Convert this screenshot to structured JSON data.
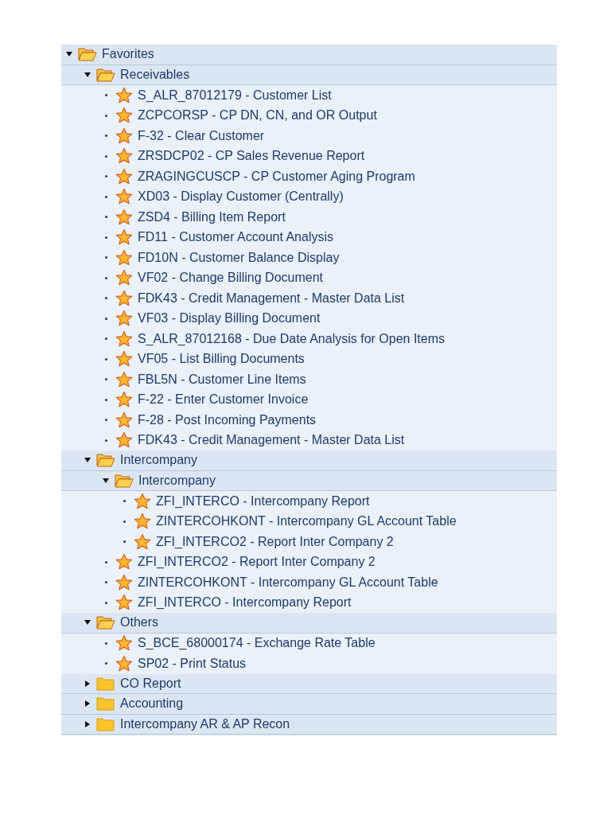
{
  "tree": [
    {
      "kind": "folder",
      "label": "Favorites",
      "expanded": true,
      "children": [
        {
          "kind": "folder",
          "label": "Receivables",
          "expanded": true,
          "children": [
            {
              "kind": "transaction",
              "label": "S_ALR_87012179 - Customer List"
            },
            {
              "kind": "transaction",
              "label": "ZCPCORSP - CP DN, CN, and OR Output"
            },
            {
              "kind": "transaction",
              "label": "F-32 - Clear Customer"
            },
            {
              "kind": "transaction",
              "label": "ZRSDCP02 - CP Sales Revenue Report"
            },
            {
              "kind": "transaction",
              "label": "ZRAGINGCUSCP - CP Customer Aging Program"
            },
            {
              "kind": "transaction",
              "label": "XD03 - Display Customer (Centrally)"
            },
            {
              "kind": "transaction",
              "label": "ZSD4 - Billing Item Report"
            },
            {
              "kind": "transaction",
              "label": "FD11 - Customer Account Analysis"
            },
            {
              "kind": "transaction",
              "label": "FD10N - Customer Balance Display"
            },
            {
              "kind": "transaction",
              "label": "VF02 - Change Billing Document"
            },
            {
              "kind": "transaction",
              "label": "FDK43 - Credit Management - Master Data List"
            },
            {
              "kind": "transaction",
              "label": "VF03 - Display Billing Document"
            },
            {
              "kind": "transaction",
              "label": "S_ALR_87012168 - Due Date Analysis for Open Items"
            },
            {
              "kind": "transaction",
              "label": "VF05 - List Billing Documents"
            },
            {
              "kind": "transaction",
              "label": "FBL5N - Customer Line Items"
            },
            {
              "kind": "transaction",
              "label": "F-22 - Enter Customer Invoice"
            },
            {
              "kind": "transaction",
              "label": "F-28 - Post Incoming Payments"
            },
            {
              "kind": "transaction",
              "label": "FDK43 - Credit Management - Master Data List"
            }
          ]
        },
        {
          "kind": "folder",
          "label": "Intercompany",
          "expanded": true,
          "children": [
            {
              "kind": "folder",
              "label": "Intercompany",
              "expanded": true,
              "children": [
                {
                  "kind": "transaction",
                  "label": "ZFI_INTERCO - Intercompany Report"
                },
                {
                  "kind": "transaction",
                  "label": "ZINTERCOHKONT - Intercompany GL Account Table"
                },
                {
                  "kind": "transaction",
                  "label": "ZFI_INTERCO2 - Report Inter Company 2"
                }
              ]
            },
            {
              "kind": "transaction",
              "label": "ZFI_INTERCO2 - Report Inter Company 2"
            },
            {
              "kind": "transaction",
              "label": "ZINTERCOHKONT - Intercompany GL Account Table"
            },
            {
              "kind": "transaction",
              "label": "ZFI_INTERCO - Intercompany Report"
            }
          ]
        },
        {
          "kind": "folder",
          "label": "Others",
          "expanded": true,
          "children": [
            {
              "kind": "transaction",
              "label": "S_BCE_68000174 - Exchange Rate Table"
            },
            {
              "kind": "transaction",
              "label": "SP02 - Print Status"
            }
          ]
        },
        {
          "kind": "folder",
          "label": "CO Report",
          "expanded": false
        },
        {
          "kind": "folder",
          "label": "Accounting",
          "expanded": false
        },
        {
          "kind": "folder",
          "label": "Intercompany AR & AP Recon",
          "expanded": false
        }
      ]
    }
  ]
}
